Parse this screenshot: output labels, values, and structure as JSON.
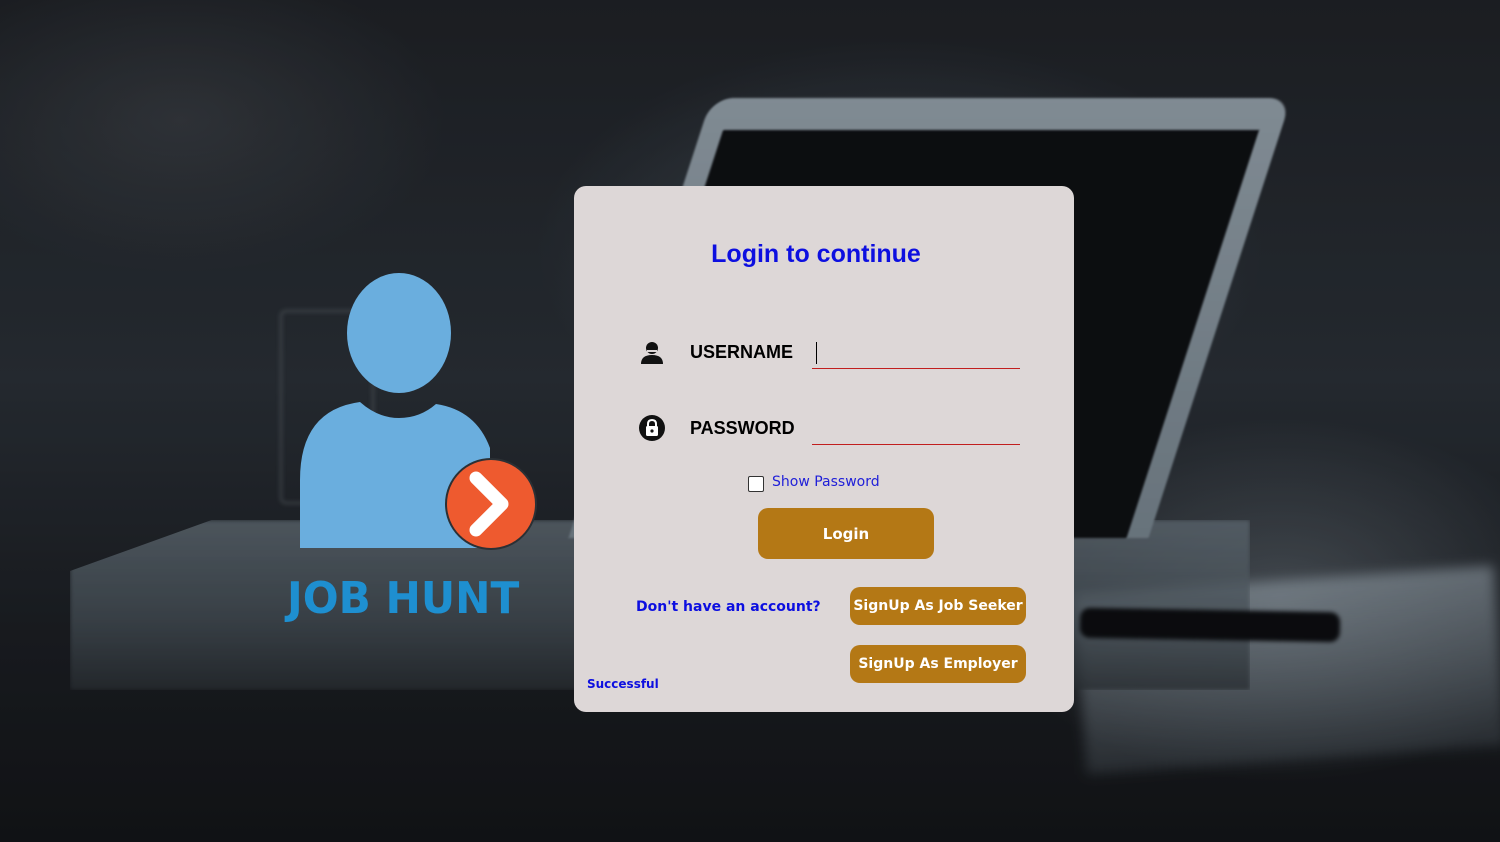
{
  "brand": {
    "name": "JOB HUNT",
    "icon": "user-arrow-icon",
    "colors": {
      "person": "#6aaede",
      "badge": "#ee5a2f",
      "text": "#1e8fd0"
    }
  },
  "login": {
    "title": "Login to continue",
    "username": {
      "label": "USERNAME",
      "icon": "user-icon",
      "value": ""
    },
    "password": {
      "label": "PASSWORD",
      "icon": "lock-icon",
      "value": ""
    },
    "show_password": {
      "label": "Show Password",
      "checked": false
    },
    "login_button": "Login",
    "no_account_text": "Don't have an account?",
    "signup_job_seeker": "SignUp As Job Seeker",
    "signup_employer": "SignUp As Employer",
    "status_text": "Successful"
  },
  "colors": {
    "card_bg": "#ddd7d7",
    "accent_blue": "#0d0fe0",
    "button": "#b47815",
    "underline": "#c11e1e"
  }
}
